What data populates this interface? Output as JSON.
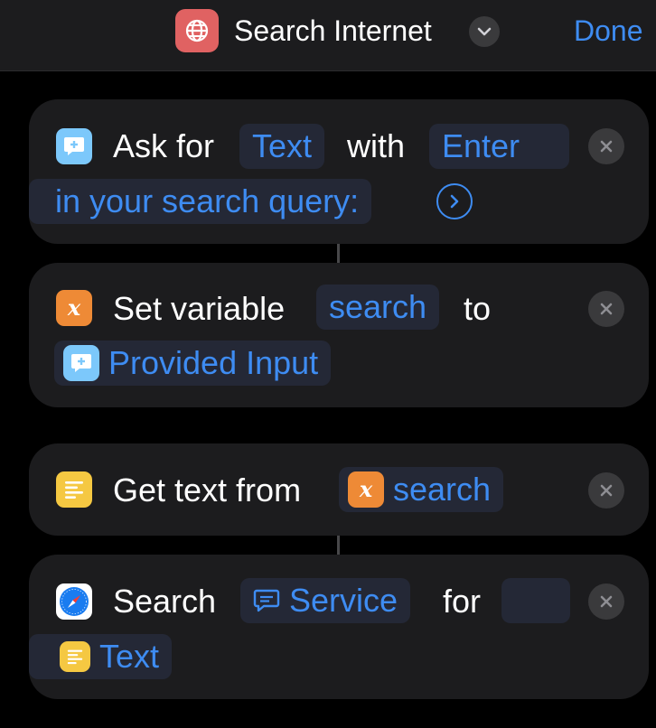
{
  "header": {
    "title": "Search Internet",
    "done_label": "Done"
  },
  "actions": [
    {
      "name": "ask-for-input",
      "text": [
        "Ask for",
        "with"
      ],
      "tokens": [
        "Text",
        "Enter",
        "in your search query:"
      ]
    },
    {
      "name": "set-variable",
      "text": [
        "Set variable",
        "to"
      ],
      "tokens": [
        "search",
        "Provided Input"
      ]
    },
    {
      "name": "get-text",
      "text": [
        "Get text from"
      ],
      "tokens": [
        "search"
      ]
    },
    {
      "name": "search-web",
      "text": [
        "Search",
        "for"
      ],
      "tokens": [
        "Service",
        "",
        "Text"
      ]
    }
  ],
  "colors": {
    "accent": "#3e8cf2",
    "background": "#000000",
    "card": "#1c1c1e",
    "token": "#242836",
    "app_icon": "#e06262"
  },
  "icons": [
    "globe-icon",
    "chevron-down-icon",
    "speech-bubble-plus-icon",
    "variable-x-icon",
    "text-lines-icon",
    "safari-compass-icon",
    "chat-bubble-icon",
    "close-icon",
    "arrow-right-circle-icon"
  ]
}
